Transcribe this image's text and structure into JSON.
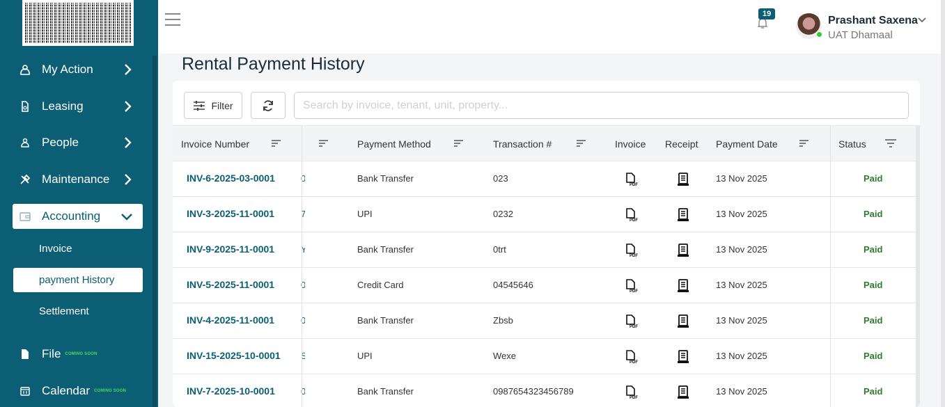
{
  "sidebar": {
    "items": [
      {
        "label": "My Action",
        "icon": "person-icon"
      },
      {
        "label": "Leasing",
        "icon": "document-icon"
      },
      {
        "label": "People",
        "icon": "person-icon"
      },
      {
        "label": "Maintenance",
        "icon": "tools-icon"
      },
      {
        "label": "Accounting",
        "icon": "wallet-icon"
      },
      {
        "label": "File",
        "icon": "file-icon",
        "badge": "COMING SOON"
      },
      {
        "label": "Calendar",
        "icon": "calendar-icon",
        "badge": "COMING SOON"
      }
    ],
    "accounting_sub": [
      {
        "label": "Invoice"
      },
      {
        "label": "payment History"
      },
      {
        "label": "Settlement"
      }
    ]
  },
  "header": {
    "notification_count": "19",
    "user_name": "Prashant Saxena",
    "user_org": "UAT Dhamaal"
  },
  "page": {
    "title": "Rental Payment History",
    "filter_label": "Filter",
    "search_placeholder": "Search by invoice, tenant, unit, property..."
  },
  "table": {
    "columns": [
      "Invoice Number",
      "Payment Method",
      "Transaction #",
      "Invoice",
      "Receipt",
      "Payment Date",
      "Status"
    ],
    "rows": [
      {
        "invoice": "INV-6-2025-03-0001",
        "trunc": "0",
        "method": "Bank Transfer",
        "txn": "023",
        "date": "13 Nov 2025",
        "status": "Paid"
      },
      {
        "invoice": "INV-3-2025-11-0001",
        "trunc": "7",
        "method": "UPI",
        "txn": "0232",
        "date": "13 Nov 2025",
        "status": "Paid"
      },
      {
        "invoice": "INV-9-2025-11-0001",
        "trunc": "Y",
        "method": "Bank Transfer",
        "txn": "0trt",
        "date": "13 Nov 2025",
        "status": "Paid"
      },
      {
        "invoice": "INV-5-2025-11-0001",
        "trunc": "0",
        "method": "Credit Card",
        "txn": "04545646",
        "date": "13 Nov 2025",
        "status": "Paid"
      },
      {
        "invoice": "INV-4-2025-11-0001",
        "trunc": "0",
        "method": "Bank Transfer",
        "txn": "Zbsb",
        "date": "13 Nov 2025",
        "status": "Paid"
      },
      {
        "invoice": "INV-15-2025-10-0001",
        "trunc": "S",
        "method": "UPI",
        "txn": "Wexe",
        "date": "13 Nov 2025",
        "status": "Paid"
      },
      {
        "invoice": "INV-7-2025-10-0001",
        "trunc": "0",
        "method": "Bank Transfer",
        "txn": "0987654323456789",
        "date": "13 Nov 2025",
        "status": "Paid"
      }
    ]
  },
  "colors": {
    "brand": "#0b5e73",
    "status_paid": "#2d7d2d",
    "soon": "#4cd964"
  }
}
